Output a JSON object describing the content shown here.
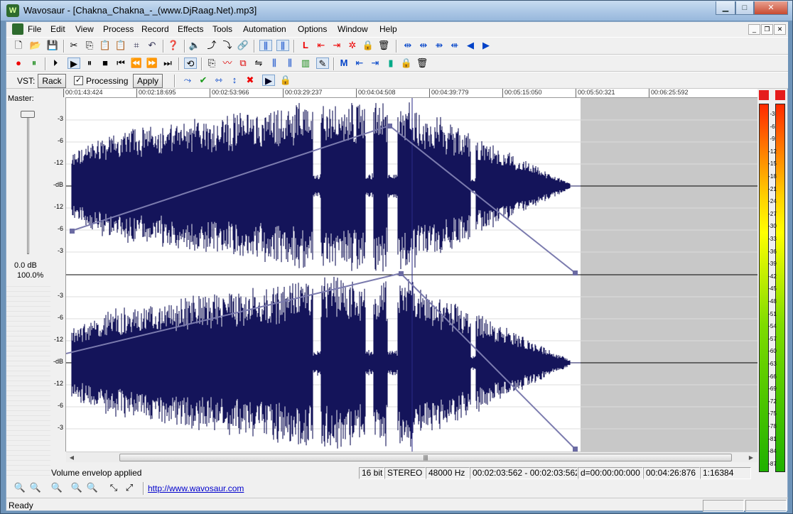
{
  "window": {
    "title": "Wavosaur - [Chakna_Chakna_-_(www.DjRaag.Net).mp3]",
    "app_icon": "wavosaur-logo-icon"
  },
  "menu": [
    "File",
    "Edit",
    "View",
    "Process",
    "Record",
    "Effects",
    "Tools",
    "Automation",
    "Options",
    "Window",
    "Help"
  ],
  "vst": {
    "label": "VST:",
    "rack": "Rack",
    "processing": "Processing",
    "processing_checked": true,
    "apply": "Apply"
  },
  "ruler": [
    "00:01:43:424",
    "00:02:18:695",
    "00:02:53:966",
    "00:03:29:237",
    "00:04:04:508",
    "00:04:39:779",
    "00:05:15:050",
    "00:05:50:321",
    "00:06:25:592"
  ],
  "master": {
    "label": "Master:",
    "db": "0.0 dB",
    "percent": "100.0%"
  },
  "db_labels_ch1": [
    "-3",
    "-6",
    "-12",
    "-dB",
    "-12",
    "-6",
    "-3"
  ],
  "db_labels_ch2": [
    "-3",
    "-6",
    "-12",
    "-dB",
    "-12",
    "-6",
    "-3"
  ],
  "meter_labels": [
    "-3",
    "-6",
    "-9",
    "-12",
    "-15",
    "-18",
    "-21",
    "-24",
    "-27",
    "-30",
    "-33",
    "-36",
    "-39",
    "-42",
    "-45",
    "-48",
    "-51",
    "-54",
    "-57",
    "-60",
    "-63",
    "-66",
    "-69",
    "-72",
    "-75",
    "-78",
    "-81",
    "-84",
    "-87"
  ],
  "status": {
    "message": "Volume envelop applied",
    "bits": "16 bit",
    "channels": "STEREO",
    "rate": "48000 Hz",
    "selection": "00:02:03:562 - 00:02:03:562",
    "delta": "d=00:00:00:000",
    "length": "00:04:26:876",
    "zoom": "1:16384"
  },
  "url": "http://www.wavosaur.com",
  "ready": "Ready",
  "colors": {
    "waveform": "#14145a",
    "envelope": "#7b7bae",
    "grey_region": "#c8c8c8"
  }
}
